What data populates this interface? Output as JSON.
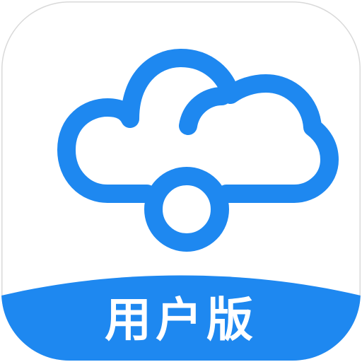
{
  "app_icon": {
    "badge_text": "用户版",
    "brand_color": "#1e88f0",
    "background_color": "#ffffff",
    "glyph": "cloud-with-circle-icon"
  }
}
